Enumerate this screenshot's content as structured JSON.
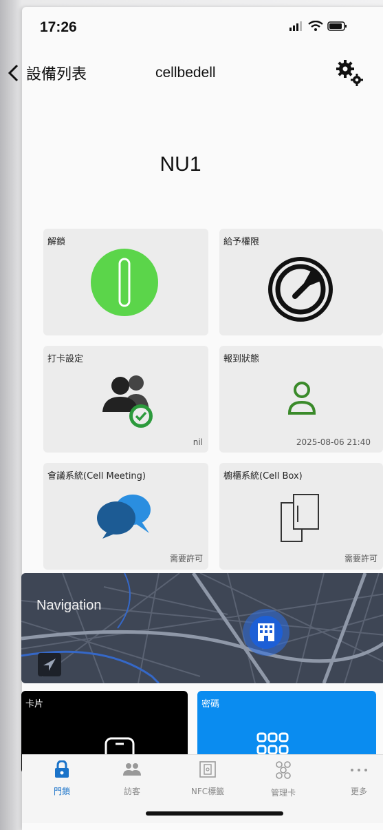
{
  "status": {
    "time": "17:26"
  },
  "nav": {
    "back_label": "設備列表",
    "title": "cellbedell"
  },
  "device": {
    "name": "NU1"
  },
  "tiles": [
    {
      "label": "解鎖",
      "footer": ""
    },
    {
      "label": "給予權限",
      "footer": ""
    },
    {
      "label": "打卡設定",
      "footer": "nil"
    },
    {
      "label": "報到狀態",
      "footer": "2025-08-06 21:40"
    },
    {
      "label": "會議系統(Cell Meeting)",
      "footer": "需要許可"
    },
    {
      "label": "櫥櫃系統(Cell Box)",
      "footer": "需要許可"
    }
  ],
  "map": {
    "label": "Navigation"
  },
  "card": {
    "label": "卡片"
  },
  "password": {
    "label": "密碼"
  },
  "tabs": [
    {
      "label": "門鎖",
      "active": true
    },
    {
      "label": "訪客",
      "active": false
    },
    {
      "label": "NFC標籤",
      "active": false
    },
    {
      "label": "管理卡",
      "active": false
    },
    {
      "label": "更多",
      "active": false
    }
  ],
  "colors": {
    "unlock": "#5bd54a",
    "checkin": "#3a8a2a",
    "chat_dark": "#1c5b94",
    "chat_light": "#2a8ee0",
    "active_tab": "#1a73c9",
    "map_bg": "#3e4655",
    "password_tile": "#0a8cf0"
  }
}
